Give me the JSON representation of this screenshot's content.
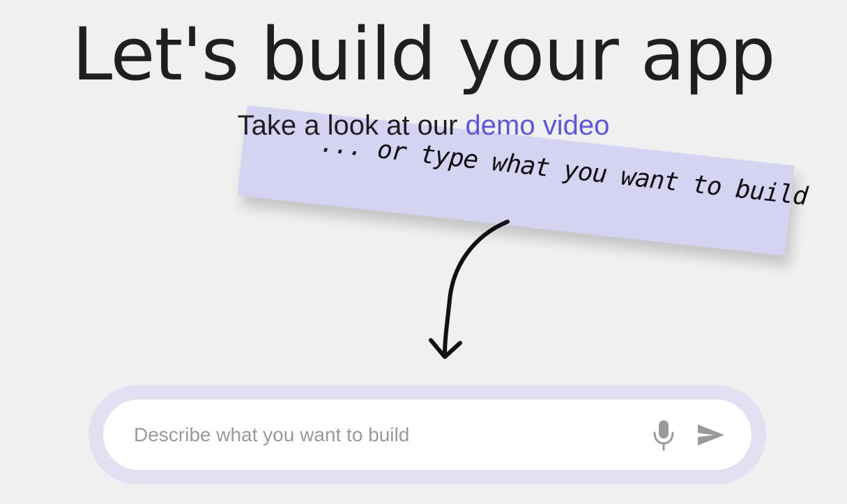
{
  "headline": "Let's build your app",
  "subline": {
    "prefix": "Take a look at our ",
    "link_label": "demo video"
  },
  "sticky_note": {
    "text": "... or type what you want to build"
  },
  "prompt": {
    "placeholder": "Describe what you want to build",
    "value": ""
  },
  "icons": {
    "mic": "microphone-icon",
    "send": "send-icon",
    "arrow": "hand-drawn-arrow"
  },
  "colors": {
    "background": "#f0f0f0",
    "accent": "#5b54e6",
    "note": "#d5d3f2",
    "prompt_ring": "#e2e0f2",
    "icon": "#9a9a9a"
  }
}
